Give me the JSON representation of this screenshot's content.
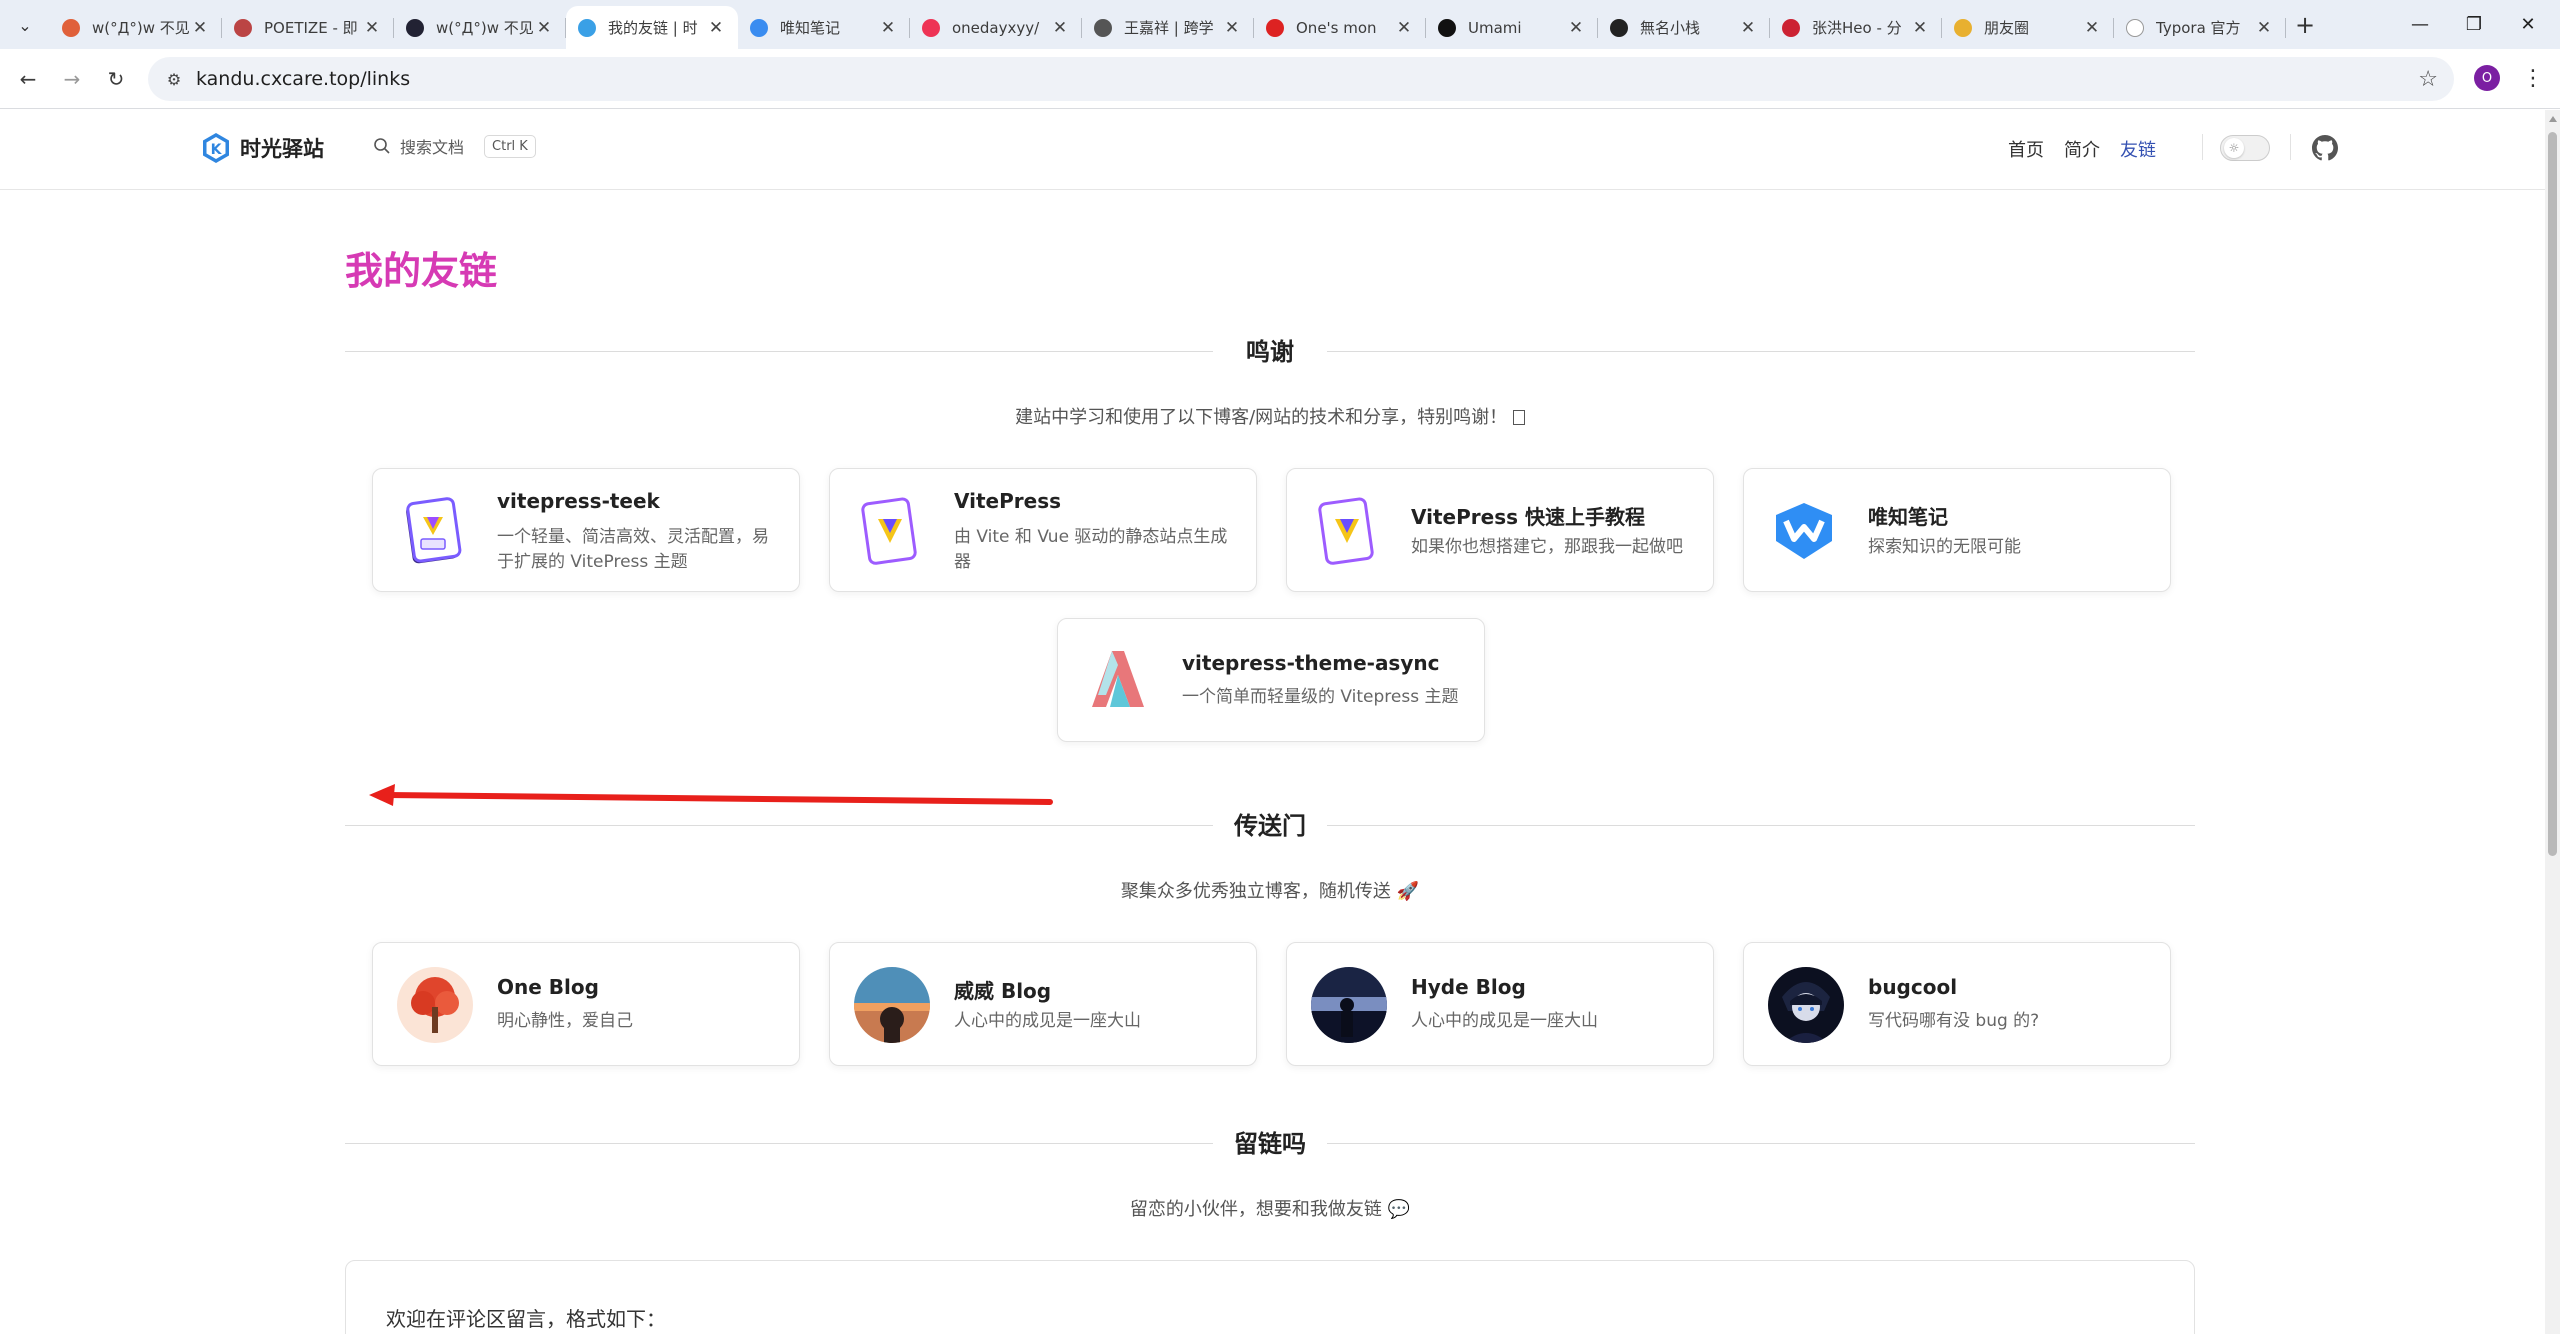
{
  "browser": {
    "tabs": [
      {
        "title": "w(°Д°)w 不见",
        "favicon_color": "#e0603a"
      },
      {
        "title": "POETIZE - 即",
        "favicon_color": "#b44"
      },
      {
        "title": "w(°Д°)w 不见",
        "favicon_color": "#223"
      },
      {
        "title": "我的友链 | 时",
        "favicon_color": "#3aa0e6"
      },
      {
        "title": "唯知笔记",
        "favicon_color": "#3a8cf0"
      },
      {
        "title": "onedayxyy/",
        "favicon_color": "#e35"
      },
      {
        "title": "王嘉祥 | 跨学",
        "favicon_color": "#555"
      },
      {
        "title": "One's mon",
        "favicon_color": "#d22"
      },
      {
        "title": "Umami",
        "favicon_color": "#111"
      },
      {
        "title": "無名小栈",
        "favicon_color": "#222"
      },
      {
        "title": "张洪Heo - 分",
        "favicon_color": "#c23"
      },
      {
        "title": "朋友圈",
        "favicon_color": "#e8b030"
      },
      {
        "title": "Typora 官方",
        "favicon_color": "#fff"
      }
    ],
    "active_tab": 3,
    "url": "kandu.cxcare.top/links",
    "profile_initial": "O"
  },
  "site": {
    "brand": "时光驿站",
    "search_label": "搜索文档",
    "search_shortcut": "Ctrl K",
    "nav": [
      "首页",
      "简介",
      "友链"
    ],
    "active_nav": 2,
    "accent_color": "#3451b2",
    "title_color": "#d63ab4"
  },
  "page": {
    "title": "我的友链",
    "sections": [
      {
        "heading": "鸣谢",
        "description": "建站中学习和使用了以下博客/网站的技术和分享，特别鸣谢！",
        "cards": [
          {
            "name": "vitepress-teek",
            "desc": "一个轻量、简洁高效、灵活配置，易于扩展的 VitePress 主题",
            "icon": "vitepress-teek-icon"
          },
          {
            "name": "VitePress",
            "desc": "由 Vite 和 Vue 驱动的静态站点生成器",
            "icon": "vitepress-icon"
          },
          {
            "name": "VitePress 快速上手教程",
            "desc": "如果你也想搭建它，那跟我一起做吧",
            "icon": "vitepress-icon"
          },
          {
            "name": "唯知笔记",
            "desc": "探索知识的无限可能",
            "icon": "weizhi-icon"
          },
          {
            "name": "vitepress-theme-async",
            "desc": "一个简单而轻量级的 Vitepress 主题",
            "icon": "async-icon"
          }
        ]
      },
      {
        "heading": "传送门",
        "description": "聚集众多优秀独立博客，随机传送 🚀",
        "cards": [
          {
            "name": "One Blog",
            "desc": "明心静性，爱自己",
            "icon": "avatar-tree"
          },
          {
            "name": "威威 Blog",
            "desc": "人心中的成见是一座大山",
            "icon": "avatar-sunset"
          },
          {
            "name": "Hyde Blog",
            "desc": "人心中的成见是一座大山",
            "icon": "avatar-night"
          },
          {
            "name": "bugcool",
            "desc": "写代码哪有没 bug 的?",
            "icon": "avatar-anime"
          }
        ]
      },
      {
        "heading": "留链吗",
        "description": "留恋的小伙伴，想要和我做友链 💬"
      }
    ],
    "comment_intro": "欢迎在评论区留言，格式如下："
  }
}
